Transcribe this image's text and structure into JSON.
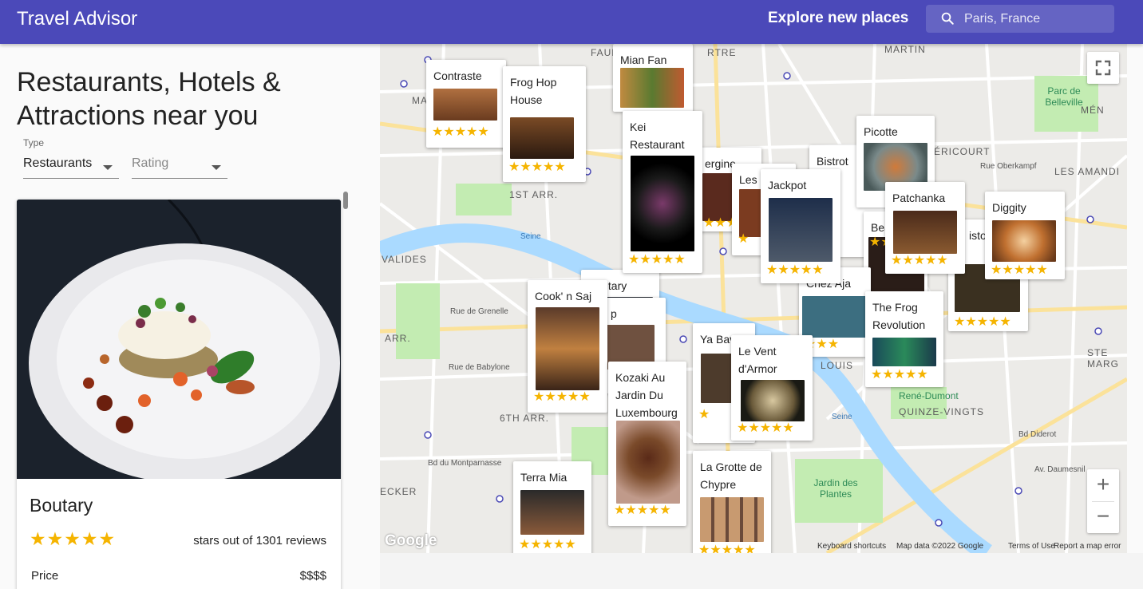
{
  "appbar": {
    "title": "Travel Advisor",
    "explore": "Explore new places",
    "search_placeholder": "Paris, France"
  },
  "left": {
    "heading": "Restaurants, Hotels & Attractions near you",
    "type_label": "Type",
    "type_value": "Restaurants",
    "rating_value": "Rating"
  },
  "card": {
    "name": "Boutary",
    "stars": "★★★★★",
    "reviews": "stars out of 1301 reviews",
    "price_label": "Price",
    "price_value": "$$$$"
  },
  "map": {
    "labels": {
      "martin": "MARTIN",
      "parc_belleville": "Parc de Belleville",
      "men": "MÉN",
      "ericourt": "ÉRICOURT",
      "rue_oberkampf": "Rue Oberkampf",
      "amandi": "LES AMANDI",
      "arr1": "1ST ARR.",
      "valides": "VALIDES",
      "arr_left": "ARR.",
      "arr6": "6TH ARR.",
      "seine1": "Seine",
      "seine2": "Seine",
      "ste_marg": "STE MARG",
      "quinze": "QUINZE-VINGTS",
      "rene_dumont": "René-Dumont",
      "jardin": "Jardin des Plantes",
      "rue_grenelle": "Rue de Grenelle",
      "rue_babylone": "Rue de Babylone",
      "bd_montparnasse": "Bd du Montparnasse",
      "ecker": "ECKER",
      "bd_diderot": "Bd Diderot",
      "av_daumesnil": "Av. Daumesnil",
      "louis": "LOUIS",
      "faub": "FAUB",
      "rtre": "RTRE",
      "ma": "MA"
    },
    "pins": [
      {
        "name": "Contraste",
        "stars": "★★★★★"
      },
      {
        "name": "Frog Hop House",
        "stars": "★★★★★"
      },
      {
        "name": "Mian Fan",
        "stars": ""
      },
      {
        "name": "Kei Restaurant",
        "stars": "★★★★★"
      },
      {
        "name": "Picotte",
        "stars": ""
      },
      {
        "name": "Bistrot",
        "stars": ""
      },
      {
        "name": "ergine",
        "stars": "★★★"
      },
      {
        "name": "Les Epicie",
        "stars": "★"
      },
      {
        "name": "Jackpot",
        "stars": "★★★★★"
      },
      {
        "name": "Patchanka",
        "stars": "★★★★★"
      },
      {
        "name": "Diggity",
        "stars": "★★★★★"
      },
      {
        "name": "Bea",
        "stars": "★★"
      },
      {
        "name": "istor",
        "stars": "★★★★★"
      },
      {
        "name": "Boutary",
        "stars": ""
      },
      {
        "name": "Cook' n Saj",
        "stars": "★★★★★"
      },
      {
        "name": "p",
        "stars": "★★"
      },
      {
        "name": "Ya Bav",
        "stars": "★"
      },
      {
        "name": "Le Vent d'Armor",
        "stars": "★★★★★"
      },
      {
        "name": "The Frog Revolution",
        "stars": "★★★★★"
      },
      {
        "name": "Kozaki Au Jardin Du Luxembourg",
        "stars": "★★★★★"
      },
      {
        "name": "Terra Mia",
        "stars": "★★★★★"
      },
      {
        "name": "La Grotte de Chypre",
        "stars": "★★★★★"
      },
      {
        "name": "Chez Aja",
        "stars": "★★★"
      }
    ],
    "attribution": {
      "google": "Google",
      "shortcuts": "Keyboard shortcuts",
      "mapdata": "Map data ©2022 Google",
      "terms": "Terms of Use",
      "report": "Report a map error"
    },
    "controls": {
      "zoom_in": "+",
      "zoom_out": "−"
    }
  },
  "colors": {
    "appbar": "#4b49b9",
    "star": "#f5b400",
    "water": "#aadaff",
    "park": "#c3ecb2"
  }
}
